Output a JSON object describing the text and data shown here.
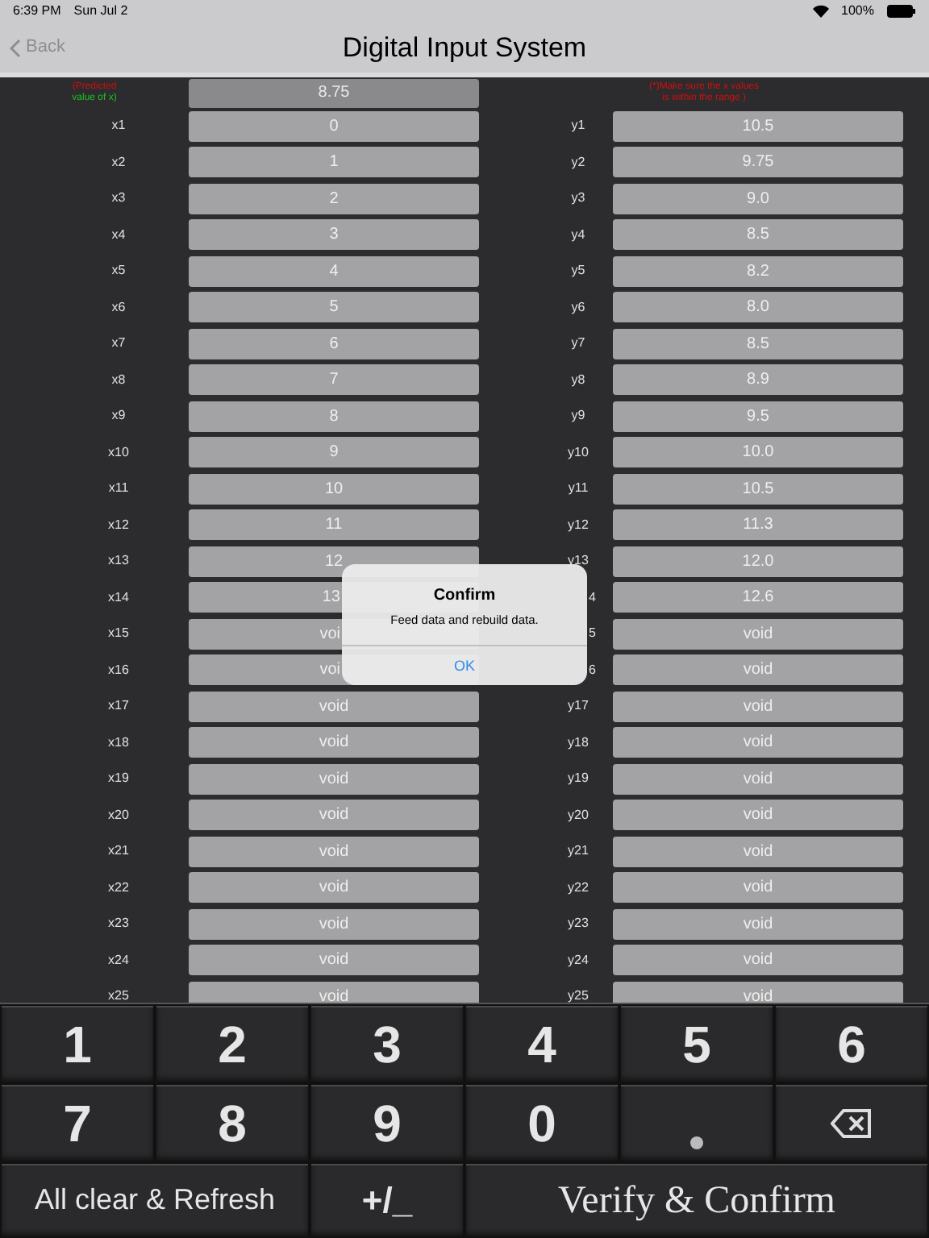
{
  "status_bar": {
    "time": "6:39 PM",
    "date": "Sun Jul 2",
    "battery": "100%"
  },
  "nav": {
    "back": "Back",
    "title": "Digital Input System"
  },
  "predicted": {
    "label_line1": "(Predicted",
    "label_line2": "value of x)",
    "value": "8.75",
    "note_line1": "(*)Make sure the x values",
    "note_line2": "is within the range )"
  },
  "rows": [
    {
      "x_label": "x1",
      "x_value": "0",
      "y_label": "y1",
      "y_value": "10.5"
    },
    {
      "x_label": "x2",
      "x_value": "1",
      "y_label": "y2",
      "y_value": "9.75"
    },
    {
      "x_label": "x3",
      "x_value": "2",
      "y_label": "y3",
      "y_value": "9.0"
    },
    {
      "x_label": "x4",
      "x_value": "3",
      "y_label": "y4",
      "y_value": "8.5"
    },
    {
      "x_label": "x5",
      "x_value": "4",
      "y_label": "y5",
      "y_value": "8.2"
    },
    {
      "x_label": "x6",
      "x_value": "5",
      "y_label": "y6",
      "y_value": "8.0"
    },
    {
      "x_label": "x7",
      "x_value": "6",
      "y_label": "y7",
      "y_value": "8.5"
    },
    {
      "x_label": "x8",
      "x_value": "7",
      "y_label": "y8",
      "y_value": "8.9"
    },
    {
      "x_label": "x9",
      "x_value": "8",
      "y_label": "y9",
      "y_value": "9.5"
    },
    {
      "x_label": "x10",
      "x_value": "9",
      "y_label": "y10",
      "y_value": "10.0"
    },
    {
      "x_label": "x11",
      "x_value": "10",
      "y_label": "y11",
      "y_value": "10.5"
    },
    {
      "x_label": "x12",
      "x_value": "11",
      "y_label": "y12",
      "y_value": "11.3"
    },
    {
      "x_label": "x13",
      "x_value": "12",
      "y_label": "y13",
      "y_value": "12.0"
    },
    {
      "x_label": "x14",
      "x_value": "13",
      "x_value_cut": true,
      "y_label": "4",
      "y_label_cut": true,
      "y_value": "12.6"
    },
    {
      "x_label": "x15",
      "x_value": "voi",
      "x_value_cut": true,
      "y_label": "5",
      "y_label_cut": true,
      "y_value": "void"
    },
    {
      "x_label": "x16",
      "x_value": "voi",
      "x_value_cut": true,
      "y_label": "6",
      "y_label_cut": true,
      "y_value": "void"
    },
    {
      "x_label": "x17",
      "x_value": "void",
      "y_label": "y17",
      "y_value": "void"
    },
    {
      "x_label": "x18",
      "x_value": "void",
      "y_label": "y18",
      "y_value": "void"
    },
    {
      "x_label": "x19",
      "x_value": "void",
      "y_label": "y19",
      "y_value": "void"
    },
    {
      "x_label": "x20",
      "x_value": "void",
      "y_label": "y20",
      "y_value": "void"
    },
    {
      "x_label": "x21",
      "x_value": "void",
      "y_label": "y21",
      "y_value": "void"
    },
    {
      "x_label": "x22",
      "x_value": "void",
      "y_label": "y22",
      "y_value": "void"
    },
    {
      "x_label": "x23",
      "x_value": "void",
      "y_label": "y23",
      "y_value": "void"
    },
    {
      "x_label": "x24",
      "x_value": "void",
      "y_label": "y24",
      "y_value": "void"
    },
    {
      "x_label": "x25",
      "x_value": "void",
      "y_label": "y25",
      "y_value": "void"
    }
  ],
  "dialog": {
    "title": "Confirm",
    "message": "Feed data and rebuild data.",
    "button": "OK"
  },
  "keypad": {
    "rows": [
      [
        {
          "kind": "digit",
          "label": "1"
        },
        {
          "kind": "digit",
          "label": "2"
        },
        {
          "kind": "digit",
          "label": "3"
        },
        {
          "kind": "digit",
          "label": "4"
        },
        {
          "kind": "digit",
          "label": "5"
        },
        {
          "kind": "digit",
          "label": "6"
        }
      ],
      [
        {
          "kind": "digit",
          "label": "7"
        },
        {
          "kind": "digit",
          "label": "8"
        },
        {
          "kind": "digit",
          "label": "9"
        },
        {
          "kind": "digit",
          "label": "0"
        },
        {
          "kind": "dot"
        },
        {
          "kind": "backspace"
        }
      ]
    ],
    "actions": [
      {
        "kind": "clear",
        "label": "All clear & Refresh"
      },
      {
        "kind": "sign",
        "label": "+/_"
      },
      {
        "kind": "verify",
        "label": "Verify & Confirm"
      }
    ]
  }
}
